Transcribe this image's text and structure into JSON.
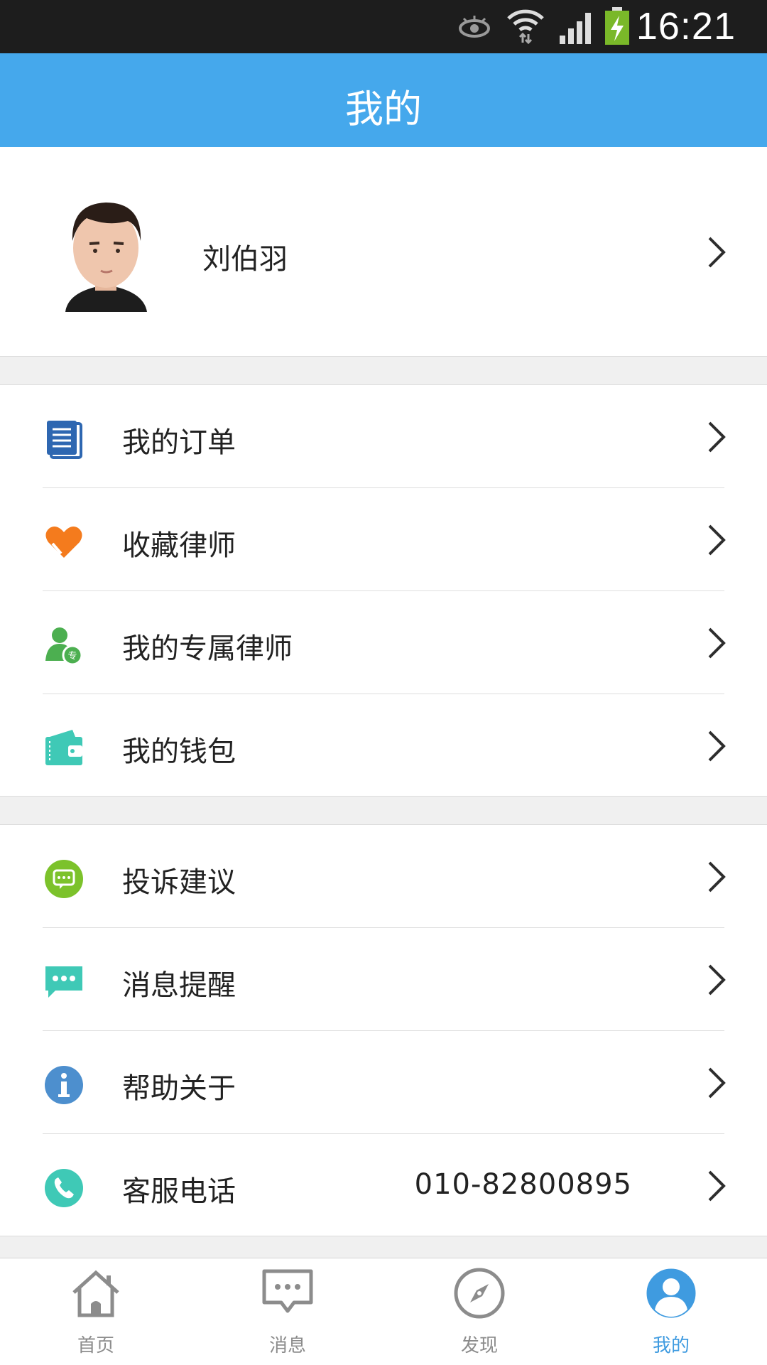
{
  "status_bar": {
    "time": "16:21"
  },
  "header": {
    "title": "我的"
  },
  "profile": {
    "name": "刘伯羽"
  },
  "menu_group_1": [
    {
      "label": "我的订单",
      "icon": "document-icon"
    },
    {
      "label": "收藏律师",
      "icon": "heart-icon"
    },
    {
      "label": "我的专属律师",
      "icon": "exclusive-lawyer-icon"
    },
    {
      "label": "我的钱包",
      "icon": "wallet-icon"
    }
  ],
  "menu_group_2": [
    {
      "label": "投诉建议",
      "icon": "feedback-icon"
    },
    {
      "label": "消息提醒",
      "icon": "message-icon"
    },
    {
      "label": "帮助关于",
      "icon": "info-icon"
    },
    {
      "label": "客服电话",
      "value": "010-82800895",
      "icon": "phone-icon"
    }
  ],
  "tab_bar": [
    {
      "label": "首页",
      "icon": "home-icon"
    },
    {
      "label": "消息",
      "icon": "chat-icon"
    },
    {
      "label": "发现",
      "icon": "compass-icon"
    },
    {
      "label": "我的",
      "icon": "user-icon",
      "active": true
    }
  ],
  "colors": {
    "header": "#45a8ec",
    "active_tab": "#3f9be0",
    "inactive_tab": "#8c8c8c"
  }
}
